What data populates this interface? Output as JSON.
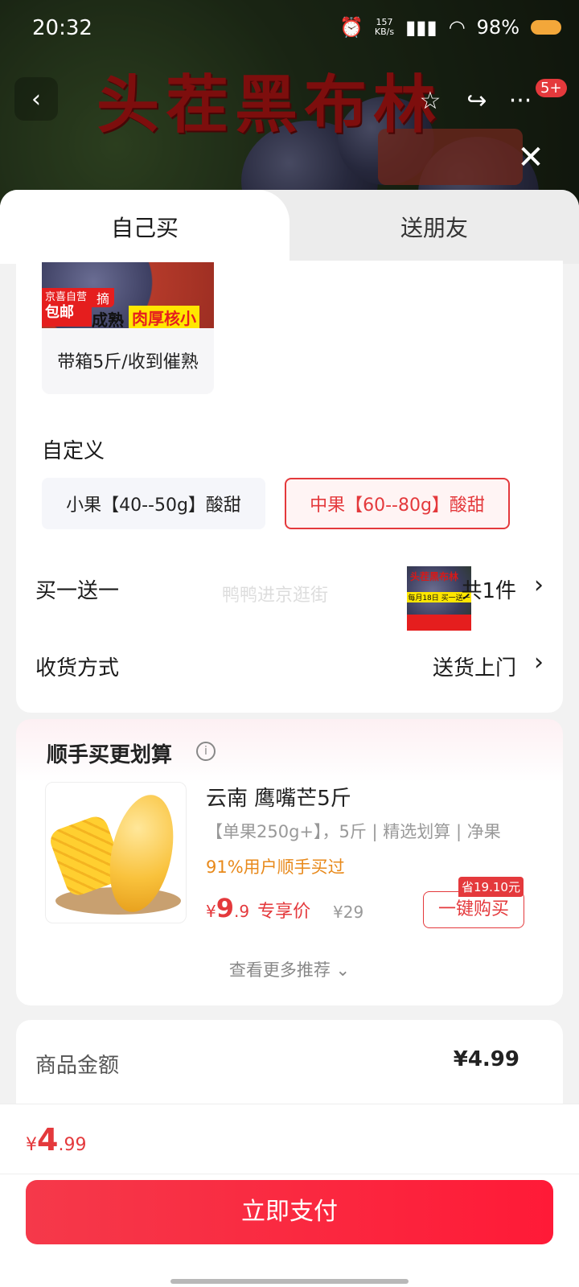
{
  "status_bar": {
    "time": "20:32",
    "net_speed": "157\nKB/s",
    "battery": "98%"
  },
  "hero": {
    "title": "头茬黑布林",
    "notification_count": "5+"
  },
  "tabs": {
    "self": "自己买",
    "friend": "送朋友"
  },
  "spec": {
    "tag_jd": "京喜自营",
    "tag_free": "包邮",
    "tag_pick": "摘",
    "tag_ripe": "成熟",
    "tag_thick": "肉厚核小",
    "label": "带箱5斤/收到催熟"
  },
  "custom": {
    "title": "自定义",
    "options": [
      {
        "label": "小果【40--50g】酸甜",
        "selected": false
      },
      {
        "label": "中果【60--80g】酸甜",
        "selected": true
      }
    ]
  },
  "bogo": {
    "label": "买一送一",
    "count": "共1件",
    "thumb_title": "头茬黑布林",
    "thumb_bar": "每月18日 买一送一"
  },
  "watermark": "鸭鸭进京逛街",
  "shipping": {
    "label": "收货方式",
    "value": "送货上门"
  },
  "recommend": {
    "title": "顺手买更划算",
    "product": {
      "name": "云南 鹰嘴芒5斤",
      "desc": "【单果250g+】，5斤 | 精选划算 | 净果",
      "buyers": "91%用户顺手买过",
      "price_symbol": "¥",
      "price_int": "9",
      "price_dec": ".9",
      "price_label": "专享价",
      "orig_price": "¥29",
      "save_badge": "省19.10元",
      "buy_label": "一键购买"
    },
    "see_more": "查看更多推荐 ⌄"
  },
  "amount": {
    "label": "商品金额",
    "value": "¥4.99"
  },
  "checkout": {
    "symbol": "¥",
    "int": "4",
    "dec": ".99",
    "pay_label": "立即支付"
  },
  "colors": {
    "accent": "#e4393c",
    "orange": "#e8891a"
  }
}
